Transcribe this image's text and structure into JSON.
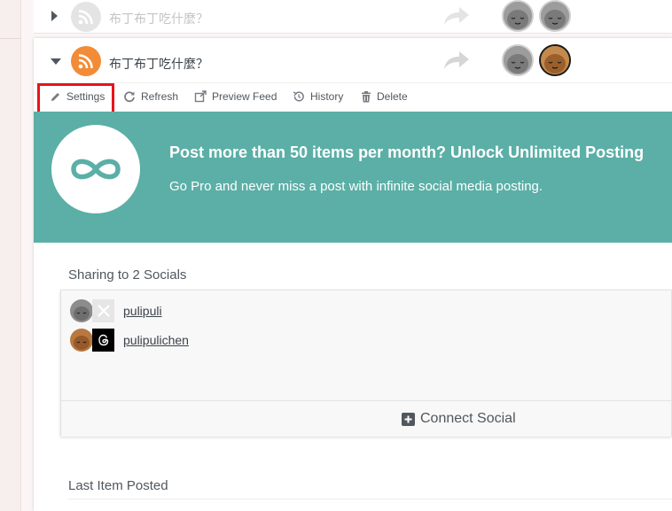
{
  "colors": {
    "rss_orange": "#f28c38",
    "promo_teal": "#5bafa6",
    "highlight_red": "#e8141b"
  },
  "feeds": [
    {
      "title": "布丁布丁吃什麼？",
      "state": "collapsed",
      "icon": "rss-icon"
    },
    {
      "title": "布丁布丁吃什麼？",
      "state": "expanded",
      "icon": "rss-icon"
    }
  ],
  "toolbar": {
    "settings_label": "Settings",
    "refresh_label": "Refresh",
    "preview_label": "Preview Feed",
    "history_label": "History",
    "delete_label": "Delete"
  },
  "promo": {
    "title": "Post more than 50 items per month? Unlock Unlimited Posting",
    "subtitle": "Go Pro and never miss a post with infinite social media posting.",
    "icon": "infinity-icon"
  },
  "sharing": {
    "heading": "Sharing to 2 Socials",
    "socials": [
      {
        "name": "pulipuli",
        "network": "x-icon"
      },
      {
        "name": "pulipulichen",
        "network": "threads-icon"
      }
    ],
    "connect_label": "Connect Social"
  },
  "last_item": {
    "heading": "Last Item Posted"
  }
}
